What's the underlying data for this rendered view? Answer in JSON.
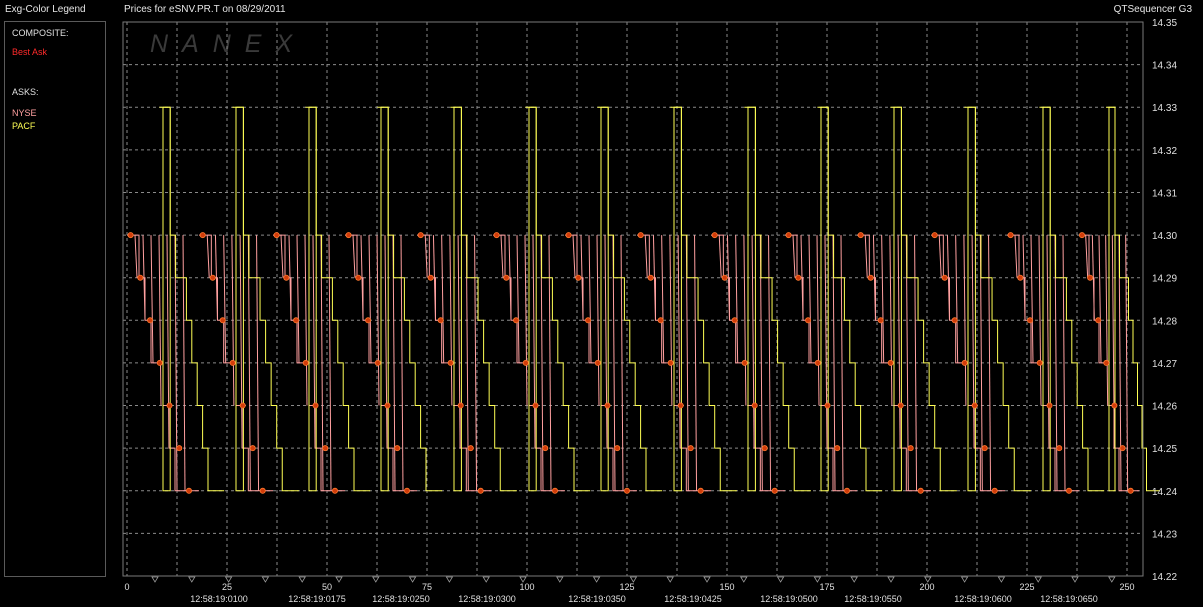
{
  "header": {
    "legend_title": "Exg-Color Legend",
    "chart_title": "Prices for  eSNV.PR.T  on  08/29/2011",
    "app_name": "QTSequencer G3"
  },
  "legend": {
    "composite_heading": "COMPOSITE:",
    "composite_item": "Best Ask",
    "asks_heading": "ASKS:",
    "ask_items": [
      "NYSE",
      "PACF"
    ]
  },
  "watermark": "NANEX",
  "colors": {
    "background": "#000000",
    "grid": "#8a8a8a",
    "frame": "#7a7a7a",
    "nyse": "#ffa0a0",
    "pacf": "#ffff55",
    "best_ask": "#d23c0a",
    "best_ask_text": "#ff2a2a",
    "watermark": "#3a3a3a"
  },
  "chart_data": {
    "type": "line",
    "title": "Prices for  eSNV.PR.T  on  08/29/2011",
    "xlabel": "",
    "ylabel": "",
    "xlim": [
      0,
      253
    ],
    "ylim": [
      14.22,
      14.35
    ],
    "yticks": [
      14.23,
      14.24,
      14.25,
      14.26,
      14.27,
      14.28,
      14.29,
      14.3,
      14.31,
      14.32,
      14.33,
      14.34
    ],
    "ytick_labels": [
      "14.22",
      "14.23",
      "14.24",
      "14.25",
      "14.26",
      "14.27",
      "14.28",
      "14.29",
      "14.30",
      "14.31",
      "14.32",
      "14.33",
      "14.34",
      "14.35"
    ],
    "xticks": [
      0,
      25,
      50,
      75,
      100,
      125,
      150,
      175,
      200,
      225,
      250
    ],
    "xtick_labels": [
      "0",
      "25",
      "50",
      "75",
      "100",
      "125",
      "150",
      "175",
      "200",
      "225",
      "250"
    ],
    "time_ticks": [
      {
        "x": 23,
        "label": "12:58:19:0100"
      },
      {
        "x": 47.5,
        "label": "12:58:19:0175"
      },
      {
        "x": 68.5,
        "label": "12:58:19:0250"
      },
      {
        "x": 90,
        "label": "12:58:19:0300"
      },
      {
        "x": 117.5,
        "label": "12:58:19:0350"
      },
      {
        "x": 141.5,
        "label": "12:58:19:0425"
      },
      {
        "x": 165.5,
        "label": "12:58:19:0500"
      },
      {
        "x": 186.5,
        "label": "12:58:19:0550"
      },
      {
        "x": 214,
        "label": "12:58:19:0600"
      },
      {
        "x": 235.5,
        "label": "12:58:19:0650"
      }
    ],
    "grid": true,
    "pattern_note": "Repeating cycle of ask prices; each cycle rises to 14.30/14.33 and steps down to 14.24",
    "series": [
      {
        "name": "NYSE",
        "cycle_values": [
          14.3,
          14.3,
          14.29,
          14.28,
          14.27,
          14.27,
          14.26,
          14.25,
          14.24,
          14.24,
          14.24,
          14.24
        ]
      },
      {
        "name": "PACF",
        "cycle_values": [
          14.33,
          14.33,
          14.3,
          14.29,
          14.29,
          14.28,
          14.27,
          14.26,
          14.25,
          14.24,
          14.24,
          14.24
        ]
      },
      {
        "name": "Best Ask",
        "marker_values": [
          14.3,
          14.29,
          14.28,
          14.27,
          14.26,
          14.25,
          14.24
        ]
      }
    ],
    "cycle_starts": [
      0,
      18,
      36.5,
      54.5,
      72.5,
      91.5,
      109.5,
      127.5,
      146,
      164.5,
      182.5,
      201,
      220,
      238
    ]
  }
}
